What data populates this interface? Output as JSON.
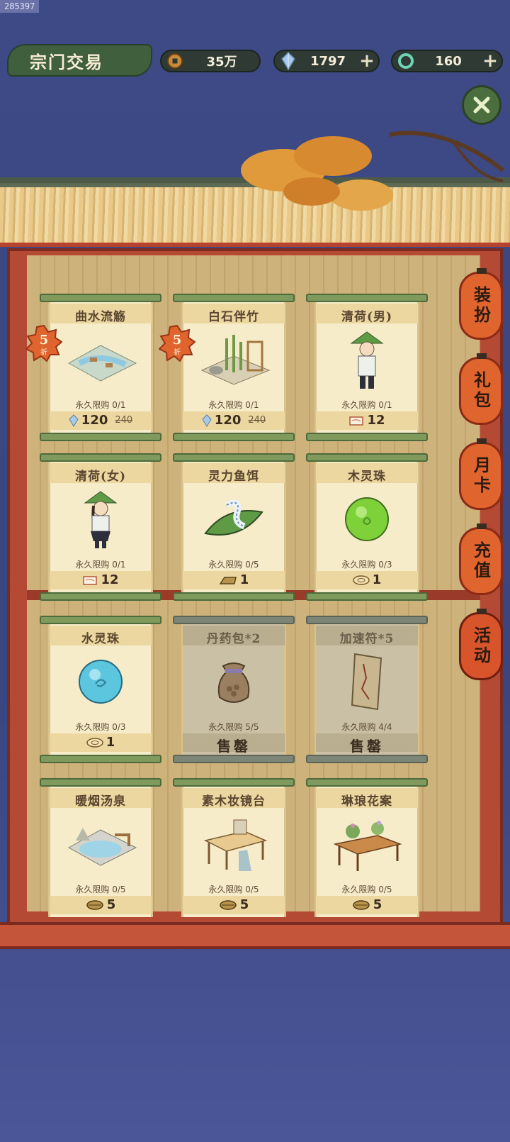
{
  "watermark": "285397",
  "header": {
    "title": "宗门交易",
    "coins": "35万",
    "gems": "1797",
    "jade": "160",
    "plus": "+"
  },
  "side_tabs": [
    "装扮",
    "礼包",
    "月卡",
    "充值",
    "活动"
  ],
  "items": [
    {
      "name": "曲水流觞",
      "limit": "永久限购 0/1",
      "price": "120",
      "old_price": "240",
      "currency": "gem",
      "badge": "5",
      "badge_sub": "折"
    },
    {
      "name": "白石伴竹",
      "limit": "永久限购 0/1",
      "price": "120",
      "old_price": "240",
      "currency": "gem",
      "badge": "5",
      "badge_sub": "折"
    },
    {
      "name": "清荷(男)",
      "limit": "永久限购 0/1",
      "price": "12",
      "currency": "ticket"
    },
    {
      "name": "清荷(女)",
      "limit": "永久限购 0/1",
      "price": "12",
      "currency": "ticket"
    },
    {
      "name": "灵力鱼饵",
      "limit": "永久限购 0/5",
      "price": "1",
      "currency": "bar"
    },
    {
      "name": "木灵珠",
      "limit": "永久限购 0/3",
      "price": "1",
      "currency": "coin"
    },
    {
      "name": "水灵珠",
      "limit": "永久限购 0/3",
      "price": "1",
      "currency": "coin"
    },
    {
      "name": "丹药包*2",
      "limit": "永久限购 5/5",
      "price": "售罄",
      "currency": "none",
      "sold": true
    },
    {
      "name": "加速符*5",
      "limit": "永久限购 4/4",
      "price": "售罄",
      "currency": "none",
      "sold": true
    },
    {
      "name": "暖烟汤泉",
      "limit": "永久限购 0/5",
      "price": "5",
      "currency": "leaf"
    },
    {
      "name": "素木妆镜台",
      "limit": "永久限购 0/5",
      "price": "5",
      "currency": "leaf"
    },
    {
      "name": "琳琅花案",
      "limit": "永久限购 0/5",
      "price": "5",
      "currency": "leaf"
    }
  ]
}
